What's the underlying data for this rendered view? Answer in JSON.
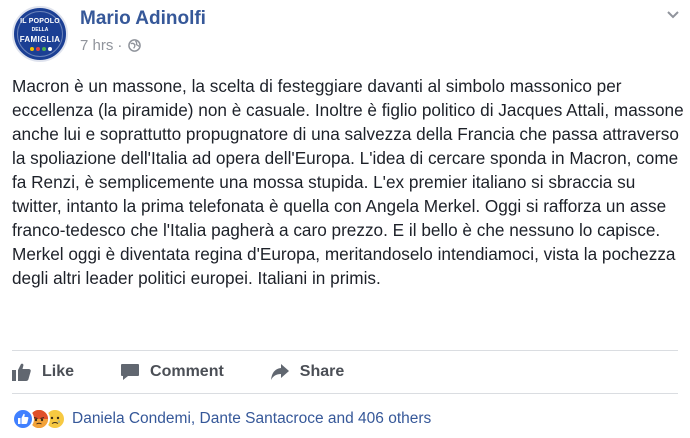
{
  "post": {
    "author": "Mario Adinolfi",
    "avatar_text": {
      "line1": "IL POPOLO",
      "line2": "DELLA",
      "line3": "FAMIGLIA"
    },
    "time": "7 hrs",
    "separator": "·",
    "audience_icon": "globe-icon",
    "text": "Macron è un massone, la scelta di festeggiare davanti al simbolo massonico per eccellenza (la piramide) non è casuale. Inoltre è figlio politico di Jacques Attali, massone anche lui e soprattutto propugnatore di una salvezza della Francia che passa attraverso la spoliazione dell'Italia ad opera dell'Europa. L'idea di cercare sponda in Macron, come fa Renzi, è semplicemente una mossa stupida. L'ex premier italiano si sbraccia su twitter, intanto la prima telefonata è quella con Angela Merkel. Oggi si rafforza un asse franco-tedesco che l'Italia pagherà a caro prezzo. E il bello è che nessuno lo capisce. Merkel oggi è diventata regina d'Europa, meritandoselo intendiamoci, vista la pochezza degli altri leader politici europei. Italiani in primis."
  },
  "actions": {
    "like_label": "Like",
    "comment_label": "Comment",
    "share_label": "Share"
  },
  "reactions": {
    "icons": [
      "like-reaction-icon",
      "angry-reaction-icon",
      "sad-reaction-icon"
    ],
    "summary": "Daniela Condemi, Dante Santacroce and 406 others"
  },
  "colors": {
    "link": "#365899",
    "meta": "#90949c",
    "action": "#4b4f56",
    "avatar_bg": "#1b3f94"
  }
}
